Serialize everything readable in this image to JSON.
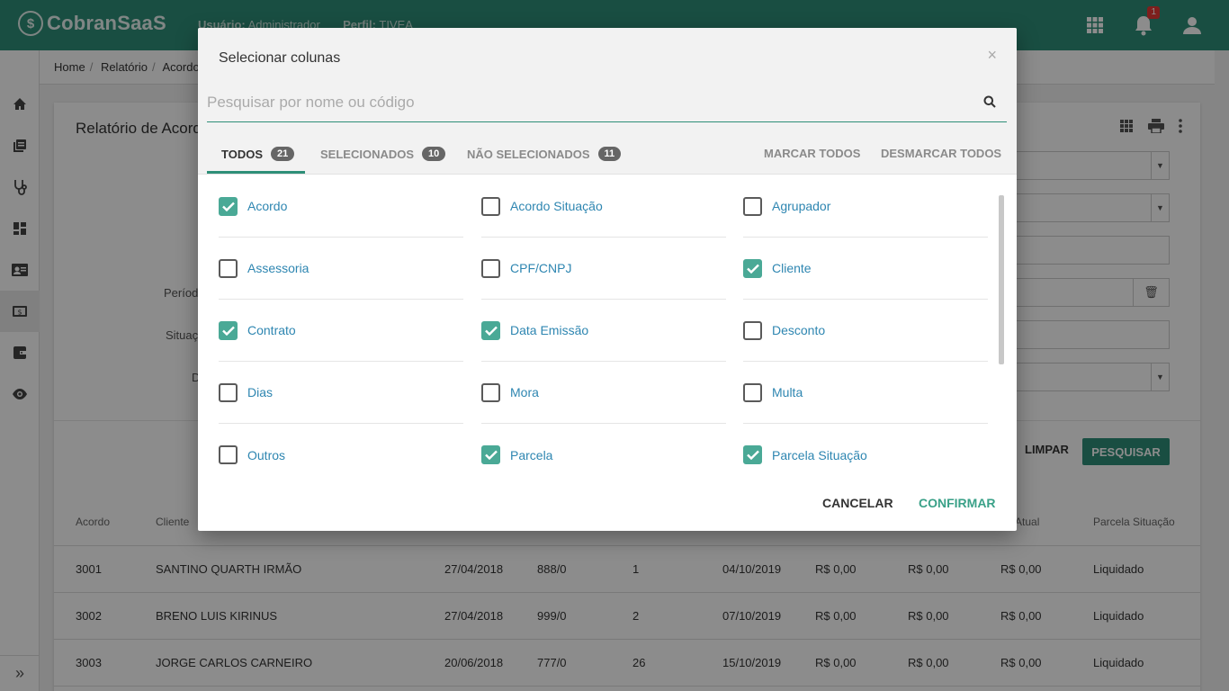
{
  "app": {
    "logo_mark": "$",
    "logo_text": "CobranSaaS",
    "user_label": "Usuário:",
    "user_value": "Administrador",
    "profile_label": "Perfil:",
    "profile_value": "TIVEA",
    "notification_count": "1"
  },
  "breadcrumb": [
    "Home",
    "Relatório",
    "Acordo"
  ],
  "page": {
    "title": "Relatório de Acordo",
    "filter_labels": [
      "Período",
      "Situação",
      "D"
    ],
    "limpar": "LIMPAR",
    "pesquisar": "PESQUISAR",
    "table_headers": [
      "Acordo",
      "Cliente",
      "",
      "",
      "",
      "",
      "",
      "",
      "do Atual",
      "Parcela Situação"
    ],
    "rows": [
      [
        "3001",
        "SANTINO QUARTH IRMÃO",
        "27/04/2018",
        "888/0",
        "1",
        "04/10/2019",
        "R$ 0,00",
        "R$ 0,00",
        "R$ 0,00",
        "Liquidado"
      ],
      [
        "3002",
        "BRENO LUIS KIRINUS",
        "27/04/2018",
        "999/0",
        "2",
        "07/10/2019",
        "R$ 0,00",
        "R$ 0,00",
        "R$ 0,00",
        "Liquidado"
      ],
      [
        "3003",
        "JORGE CARLOS CARNEIRO",
        "20/06/2018",
        "777/0",
        "26",
        "15/10/2019",
        "R$ 0,00",
        "R$ 0,00",
        "R$ 0,00",
        "Liquidado"
      ]
    ]
  },
  "modal": {
    "title": "Selecionar colunas",
    "close": "×",
    "search_placeholder": "Pesquisar por nome ou código",
    "tabs": [
      {
        "label": "TODOS",
        "count": "21"
      },
      {
        "label": "SELECIONADOS",
        "count": "10"
      },
      {
        "label": "NÃO SELECIONADOS",
        "count": "11"
      }
    ],
    "mark_all": "MARCAR TODOS",
    "unmark_all": "DESMARCAR TODOS",
    "options": [
      {
        "label": "Acordo",
        "checked": true
      },
      {
        "label": "Acordo Situação",
        "checked": false
      },
      {
        "label": "Agrupador",
        "checked": false
      },
      {
        "label": "Assessoria",
        "checked": false
      },
      {
        "label": "CPF/CNPJ",
        "checked": false
      },
      {
        "label": "Cliente",
        "checked": true
      },
      {
        "label": "Contrato",
        "checked": true
      },
      {
        "label": "Data Emissão",
        "checked": true
      },
      {
        "label": "Desconto",
        "checked": false
      },
      {
        "label": "Dias",
        "checked": false
      },
      {
        "label": "Mora",
        "checked": false
      },
      {
        "label": "Multa",
        "checked": false
      },
      {
        "label": "Outros",
        "checked": false
      },
      {
        "label": "Parcela",
        "checked": true
      },
      {
        "label": "Parcela Situação",
        "checked": true
      }
    ],
    "cancel": "CANCELAR",
    "confirm": "CONFIRMAR"
  },
  "colors": {
    "brand": "#2e8f78",
    "checkbox_on": "#4aa996",
    "link": "#2e86b1"
  }
}
